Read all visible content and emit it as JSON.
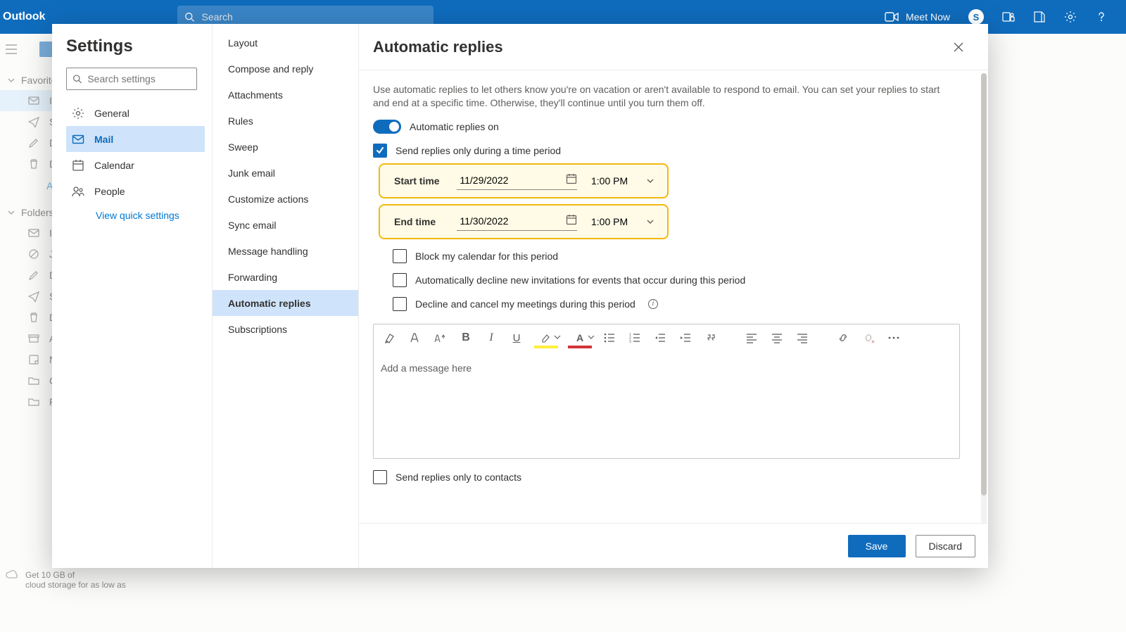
{
  "app": {
    "brand": "Outlook",
    "search_placeholder": "Search",
    "meet_now": "Meet Now"
  },
  "leftnav": {
    "favorites_label": "Favorites",
    "folders_label": "Folders",
    "add_favorite": "Add favorite",
    "promo_line1": "Get 10 GB of",
    "promo_line2": "cloud storage for as low as"
  },
  "settings": {
    "title": "Settings",
    "search_placeholder": "Search settings",
    "categories": {
      "general": "General",
      "mail": "Mail",
      "calendar": "Calendar",
      "people": "People"
    },
    "view_quick": "View quick settings",
    "mail_items": {
      "layout": "Layout",
      "compose": "Compose and reply",
      "attachments": "Attachments",
      "rules": "Rules",
      "sweep": "Sweep",
      "junk": "Junk email",
      "customize": "Customize actions",
      "sync": "Sync email",
      "handling": "Message handling",
      "forwarding": "Forwarding",
      "autoreply": "Automatic replies",
      "subscriptions": "Subscriptions"
    }
  },
  "autoreply": {
    "title": "Automatic replies",
    "description": "Use automatic replies to let others know you're on vacation or aren't available to respond to email. You can set your replies to start and end at a specific time. Otherwise, they'll continue until you turn them off.",
    "toggle_label": "Automatic replies on",
    "period_label": "Send replies only during a time period",
    "start_label": "Start time",
    "end_label": "End time",
    "start_date": "11/29/2022",
    "start_time": "1:00 PM",
    "end_date": "11/30/2022",
    "end_time": "1:00 PM",
    "block_cal": "Block my calendar for this period",
    "decline_new": "Automatically decline new invitations for events that occur during this period",
    "cancel_meet": "Decline and cancel my meetings during this period",
    "editor_placeholder": "Add a message here",
    "contacts_only": "Send replies only to contacts",
    "save": "Save",
    "discard": "Discard"
  }
}
